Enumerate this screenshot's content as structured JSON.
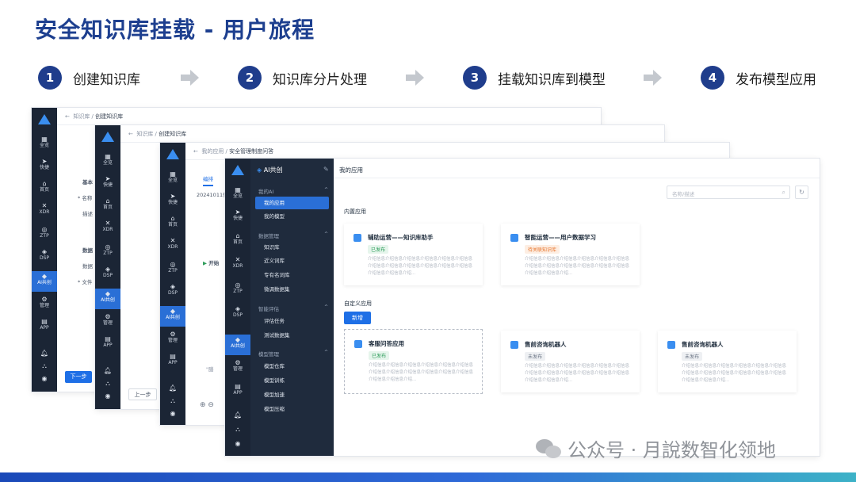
{
  "title": "安全知识库挂载 - 用户旅程",
  "steps": [
    {
      "num": "1",
      "label": "创建知识库"
    },
    {
      "num": "2",
      "label": "知识库分片处理"
    },
    {
      "num": "3",
      "label": "挂载知识库到模型"
    },
    {
      "num": "4",
      "label": "发布模型应用"
    }
  ],
  "nav": [
    "全览",
    "快捷",
    "首页",
    "XDR",
    "ZTP",
    "DSP",
    "AI共创",
    "管理",
    "APP"
  ],
  "window1": {
    "breadcrumb_parent": "知识库",
    "breadcrumb_current": "创建知识库",
    "section_basic": "基本",
    "field_name": "* 名称",
    "field_desc": "描述",
    "section_data": "数据",
    "field_data": "数据",
    "field_file": "* 文件",
    "next_button": "下一步"
  },
  "window2": {
    "breadcrumb_parent": "知识库",
    "breadcrumb_current": "创建知识库",
    "prev_button": "上一步"
  },
  "window3": {
    "breadcrumb_parent": "我的应用",
    "breadcrumb_current": "安全管理制度问答",
    "tab_edit": "编排",
    "date_text": "20241011信",
    "start_text": "开始",
    "quote_text": "\"膳"
  },
  "window4": {
    "header_brand": "AI共创",
    "page_title": "我的应用",
    "search_placeholder": "名称/描述",
    "menu": {
      "my_ai": "我的AI",
      "my_apps": "我的应用",
      "my_models": "我的模型",
      "data_mgmt": "数据管理",
      "knowledge_base": "知识库",
      "synonyms": "近义词库",
      "proper_nouns": "专有名词库",
      "finetune_data": "微调数据集",
      "smart_eval": "智能评估",
      "eval_tasks": "评估任务",
      "test_data": "测试数据集",
      "model_mgmt": "模型管理",
      "model_repo": "模型仓库",
      "model_train": "模型训练",
      "model_accel": "模型加速",
      "model_compress": "模型压缩"
    },
    "builtin_title": "内置应用",
    "custom_title": "自定义应用",
    "new_button": "新增",
    "desc_text": "介绍信息介绍信息介绍信息介绍信息介绍信息介绍信息介绍信息介绍信息介绍信息介绍信息介绍信息介绍信息介绍信息介绍信息介绍...",
    "builtin_cards": [
      {
        "name": "辅助运营——知识库助手",
        "tag": "已发布"
      },
      {
        "name": "智能运营——用户数据学习",
        "tag": "待关联知识库"
      }
    ],
    "custom_cards": [
      {
        "name": "客服问答应用",
        "tag": "已发布"
      },
      {
        "name": "售前咨询机器人",
        "tag": "未发布"
      },
      {
        "name": "售前咨询机器人",
        "tag": "未发布"
      }
    ]
  },
  "colors": {
    "accent": "#1e6fe6",
    "title": "#1d3f8f",
    "nav_bg": "#1b2535",
    "published": "#2e9d5a",
    "pending": "#e8742a"
  },
  "watermark": "公众号 · 月說数智化领地"
}
